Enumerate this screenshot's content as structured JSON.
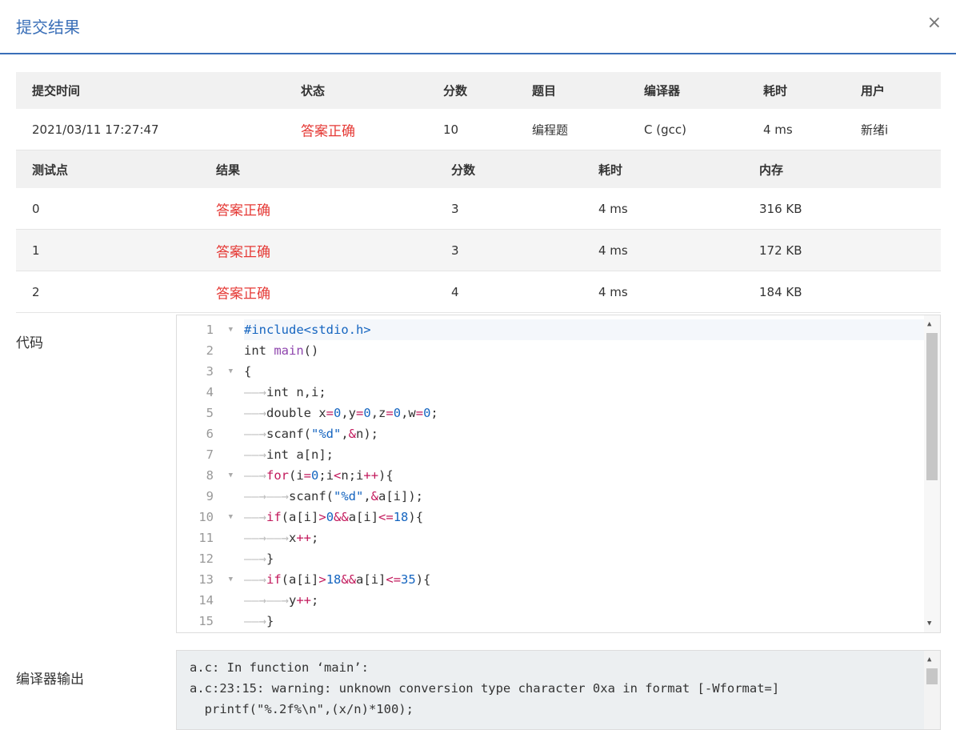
{
  "dialog": {
    "title": "提交结果",
    "close_glyph": "×"
  },
  "summary": {
    "headers": [
      "提交时间",
      "状态",
      "分数",
      "题目",
      "编译器",
      "耗时",
      "用户"
    ],
    "values": [
      "2021/03/11 17:27:47",
      "答案正确",
      "10",
      "编程题",
      "C (gcc)",
      "4 ms",
      "新绪i"
    ]
  },
  "tests": {
    "headers": [
      "测试点",
      "结果",
      "分数",
      "耗时",
      "内存"
    ],
    "rows": [
      [
        "0",
        "答案正确",
        "3",
        "4 ms",
        "316 KB"
      ],
      [
        "1",
        "答案正确",
        "3",
        "4 ms",
        "172 KB"
      ],
      [
        "2",
        "答案正确",
        "4",
        "4 ms",
        "184 KB"
      ]
    ]
  },
  "code": {
    "label": "代码",
    "line_numbers": [
      "1",
      "2",
      "3",
      "4",
      "5",
      "6",
      "7",
      "8",
      "9",
      "10",
      "11",
      "12",
      "13",
      "14",
      "15"
    ],
    "lines": [
      "#include<stdio.h>",
      "int main()",
      "{",
      "    int n,i;",
      "    double x=0,y=0,z=0,w=0;",
      "    scanf(\"%d\",&n);",
      "    int a[n];",
      "    for(i=0;i<n;i++){",
      "        scanf(\"%d\",&a[i]);",
      "    if(a[i]>0&&a[i]<=18){",
      "        x++;",
      "    }",
      "    if(a[i]>18&&a[i]<=35){",
      "        y++;",
      "    }"
    ]
  },
  "compiler_output": {
    "label": "编译器输出",
    "lines": [
      "a.c: In function ‘main’:",
      "a.c:23:15: warning: unknown conversion type character 0xa in format [-Wformat=]",
      "  printf(\"%.2f%\\n\",(x/n)*100);"
    ]
  },
  "colors": {
    "accent": "#3a6fb8",
    "success_text": "#e53935"
  }
}
